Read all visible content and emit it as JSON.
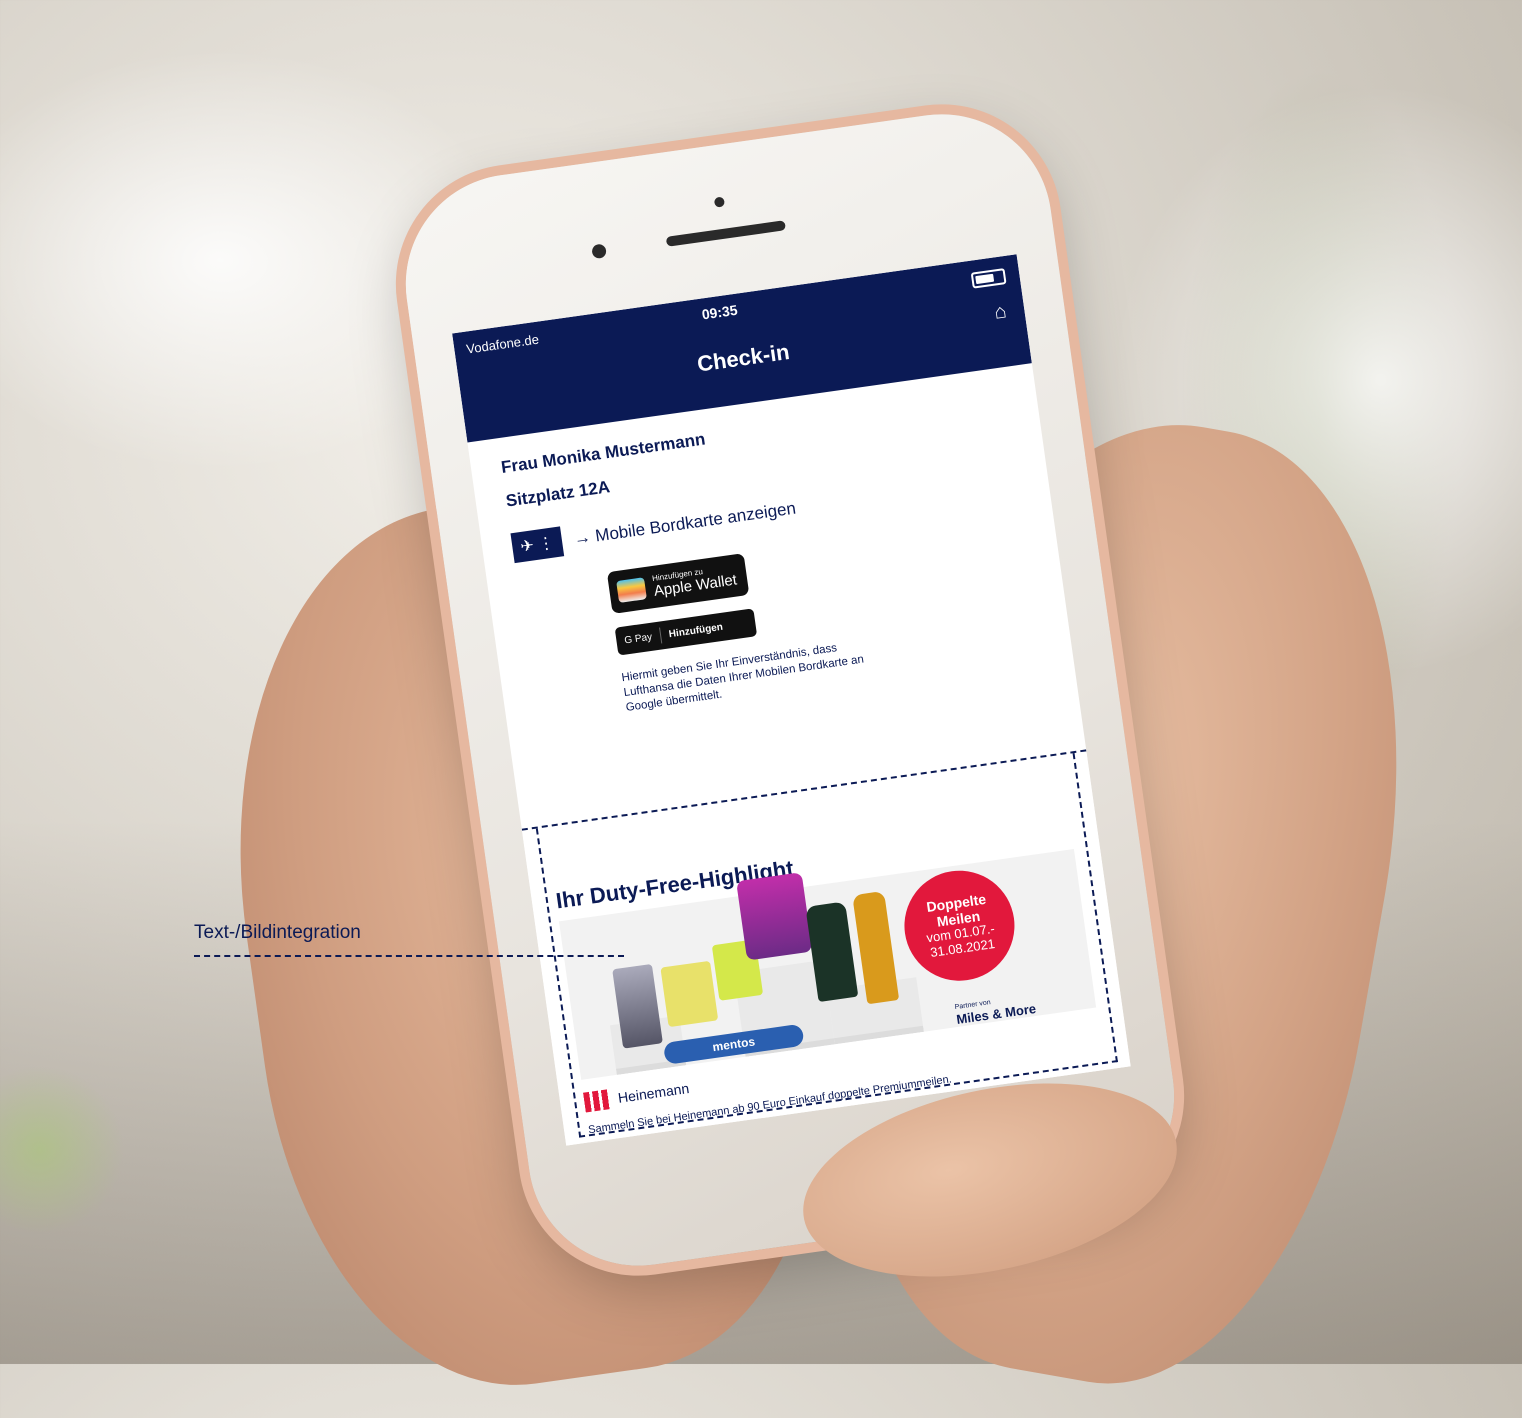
{
  "annotation": {
    "label": "Text-/Bildintegration"
  },
  "status_bar": {
    "carrier": "Vodafone.de",
    "time": "09:35"
  },
  "nav": {
    "title": "Check-in"
  },
  "checkin": {
    "passenger": "Frau Monika Mustermann",
    "seat": "Sitzplatz 12A",
    "boarding_pass_link": "→ Mobile Bordkarte anzeigen",
    "apple_wallet": {
      "small": "Hinzufügen zu",
      "label": "Apple Wallet"
    },
    "google_pay": {
      "brand": "G Pay",
      "label": "Hinzufügen"
    },
    "consent_text": "Hiermit geben Sie Ihr Einverständnis, dass Lufthansa die Daten Ihrer Mobilen Bordkarte an Google übermittelt."
  },
  "promo": {
    "title": "Ihr Duty-Free-Highlight",
    "badge": {
      "line1": "Doppelte",
      "line2": "Meilen",
      "line3": "vom 01.07.-",
      "line4": "31.08.2021"
    },
    "partner_small": "Partner von",
    "partner_name": "Miles & More",
    "product_mentos": "mentos",
    "brand": "Heinemann",
    "footer": "Sammeln Sie bei Heinemann ab 90 Euro Einkauf doppelte Premiummeilen."
  },
  "colors": {
    "navy": "#0b1a55",
    "badge_red": "#e2183c"
  },
  "icons": [
    "home-icon",
    "battery-icon",
    "plane-icon",
    "wallet-icon"
  ]
}
